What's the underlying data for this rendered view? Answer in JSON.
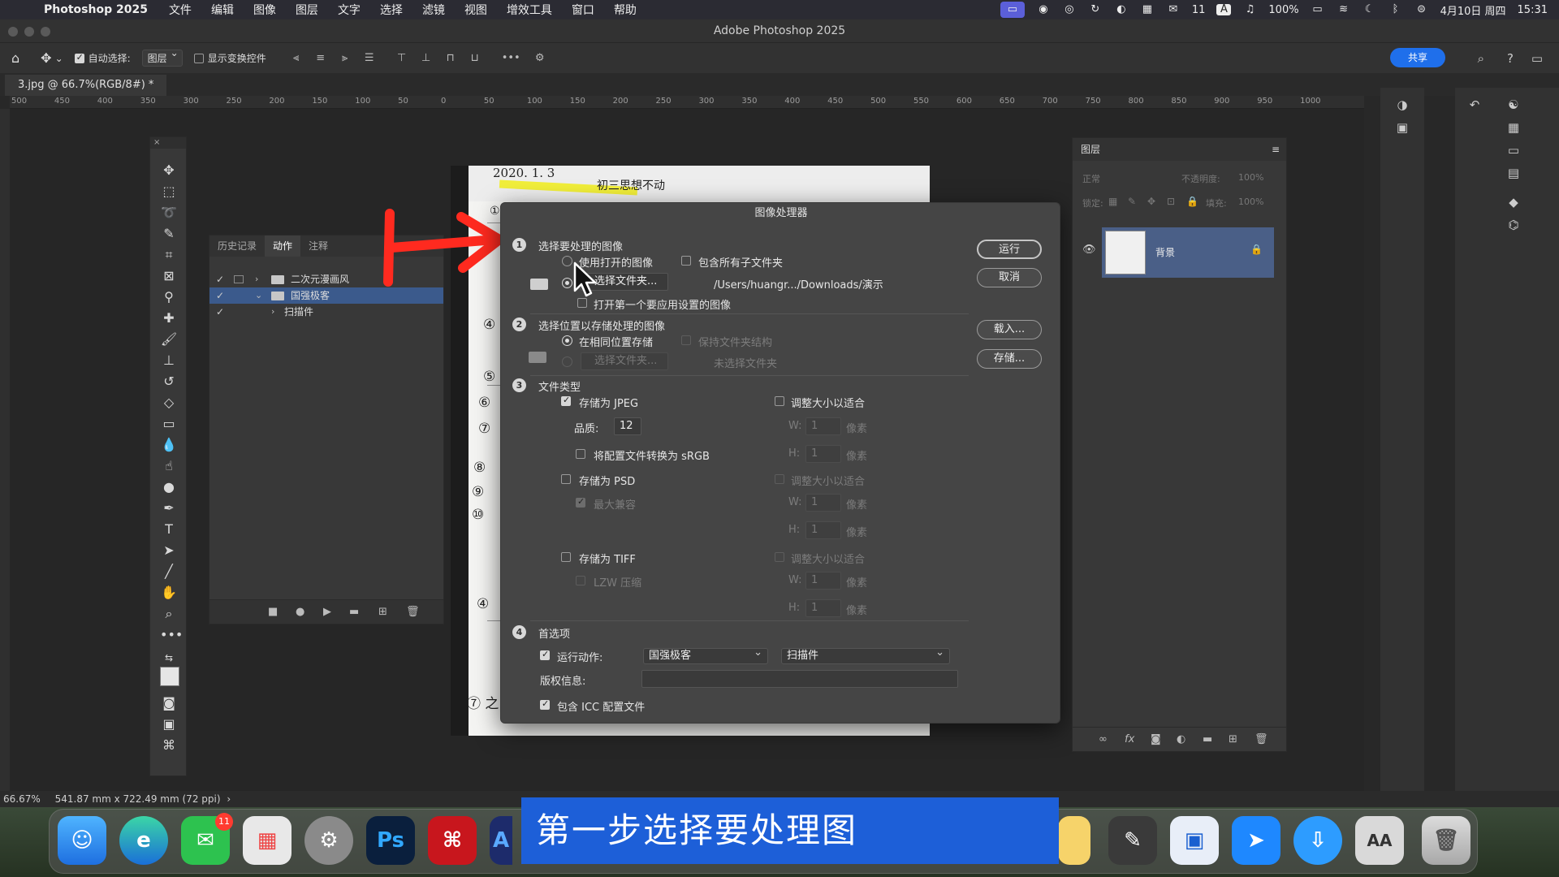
{
  "menubar": {
    "app_name": "Photoshop 2025",
    "items": [
      "文件",
      "编辑",
      "图像",
      "图层",
      "文字",
      "选择",
      "滤镜",
      "视图",
      "增效工具",
      "窗口",
      "帮助"
    ],
    "wechat_count": "11",
    "input_method": "A",
    "battery": "100%",
    "date": "4月10日 周四",
    "time": "15:31"
  },
  "window": {
    "title": "Adobe Photoshop 2025"
  },
  "options_bar": {
    "auto_select_label": "自动选择:",
    "auto_select_value": "图层",
    "show_transform_label": "显示变换控件",
    "share_label": "共享"
  },
  "document": {
    "tab_title": "3.jpg @ 66.7%(RGB/8#) *"
  },
  "ruler": {
    "ticks": [
      "500",
      "450",
      "400",
      "350",
      "300",
      "250",
      "200",
      "150",
      "100",
      "50",
      "0",
      "50",
      "100",
      "150",
      "200",
      "250",
      "300",
      "350",
      "400",
      "450",
      "500",
      "550",
      "600",
      "650",
      "700",
      "750",
      "800",
      "850",
      "900",
      "950",
      "1000"
    ]
  },
  "actions_panel": {
    "tabs": [
      "历史记录",
      "动作",
      "注释"
    ],
    "rows": [
      {
        "label": "二次元漫画风"
      },
      {
        "label": "国强极客"
      },
      {
        "label": "扫描件"
      }
    ]
  },
  "canvas": {
    "handwriting": [
      "2020. 1. 3",
      "初三思想不动",
      "①",
      "⑤",
      "⑥",
      "⑦",
      "⑧",
      "⑨",
      "⑩",
      "④",
      "④",
      "⑦ 之"
    ]
  },
  "dialog": {
    "title": "图像处理器",
    "section1": {
      "num": "1",
      "title": "选择要处理的图像",
      "use_open_label": "使用打开的图像",
      "include_sub_label": "包含所有子文件夹",
      "select_folder_label": "选择文件夹...",
      "folder_path": "/Users/huangr.../Downloads/演示",
      "open_first_label": "打开第一个要应用设置的图像"
    },
    "section2": {
      "num": "2",
      "title": "选择位置以存储处理的图像",
      "same_location_label": "在相同位置存储",
      "keep_structure_label": "保持文件夹结构",
      "select_folder_label": "选择文件夹...",
      "no_folder_label": "未选择文件夹"
    },
    "section3": {
      "num": "3",
      "title": "文件类型",
      "save_jpeg_label": "存储为 JPEG",
      "resize_label": "调整大小以适合",
      "quality_label": "品质:",
      "quality_value": "12",
      "w_label": "W:",
      "h_label": "H:",
      "w_value": "1",
      "h_value": "1",
      "px_label": "像素",
      "srgb_label": "将配置文件转换为 sRGB",
      "save_psd_label": "存储为 PSD",
      "max_compat_label": "最大兼容",
      "save_tiff_label": "存储为 TIFF",
      "lzw_label": "LZW 压缩"
    },
    "section4": {
      "num": "4",
      "title": "首选项",
      "run_action_label": "运行动作:",
      "action_set": "国强极客",
      "action_name": "扫描件",
      "copyright_label": "版权信息:",
      "icc_label": "包含 ICC 配置文件"
    },
    "buttons": {
      "run": "运行",
      "cancel": "取消",
      "load": "载入...",
      "save": "存储..."
    }
  },
  "layers_panel": {
    "title": "图层",
    "blend_mode": "正常",
    "opacity_label": "不透明度:",
    "opacity_value": "100%",
    "lock_label": "锁定:",
    "fill_label": "填充:",
    "fill_value": "100%",
    "layer_name": "背景"
  },
  "status_bar": {
    "zoom": "66.67%",
    "doc_size": "541.87 mm x 722.49 mm (72 ppi)"
  },
  "dock": {
    "wechat_badge": "11",
    "photoshop_label": "Ps"
  },
  "subtitle": {
    "text": "第一步选择要处理图"
  }
}
